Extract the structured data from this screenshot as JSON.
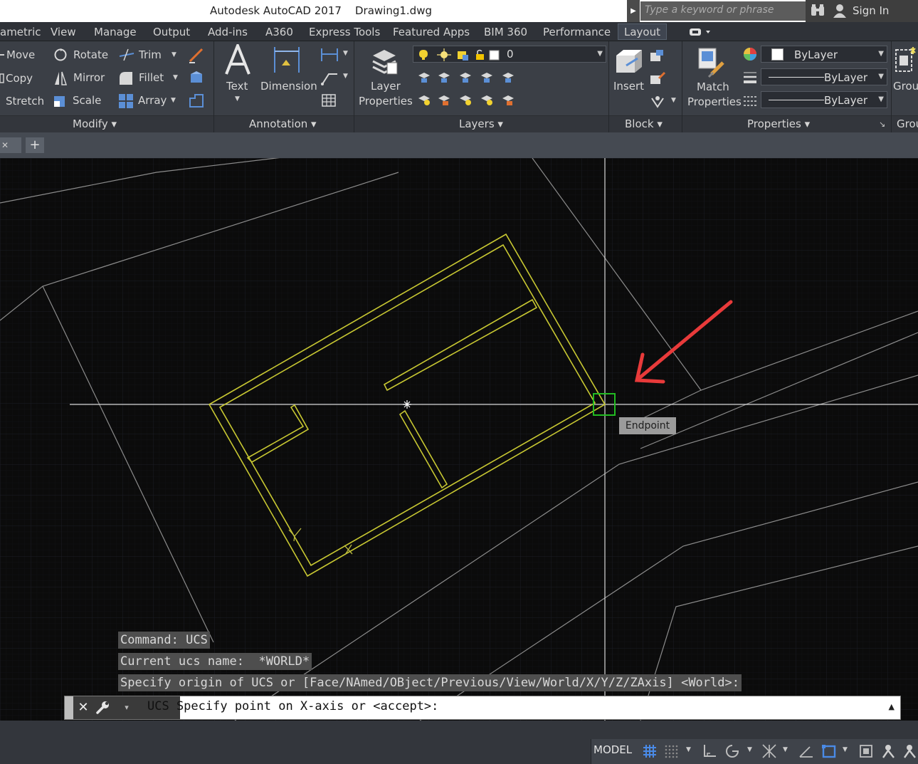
{
  "window": {
    "app_name": "Autodesk AutoCAD 2017",
    "document": "Drawing1.dwg",
    "search_placeholder": "Type a keyword or phrase",
    "sign_in": "Sign In"
  },
  "ribbon_tabs": [
    "ametric",
    "View",
    "Manage",
    "Output",
    "Add-ins",
    "A360",
    "Express Tools",
    "Featured Apps",
    "BIM 360",
    "Performance",
    "Layout"
  ],
  "active_tab": "Layout",
  "modify_panel": {
    "title": "Modify",
    "move": "Move",
    "rotate": "Rotate",
    "trim": "Trim",
    "copy": "Copy",
    "mirror": "Mirror",
    "fillet": "Fillet",
    "stretch": "Stretch",
    "scale": "Scale",
    "array": "Array"
  },
  "annotation_panel": {
    "title": "Annotation",
    "text": "Text",
    "dimension": "Dimension"
  },
  "layers_panel": {
    "title": "Layers",
    "layer_properties_1": "Layer",
    "layer_properties_2": "Properties",
    "current_layer": "0"
  },
  "block_panel": {
    "title": "Block",
    "insert": "Insert"
  },
  "properties_panel": {
    "title": "Properties",
    "match_1": "Match",
    "match_2": "Properties",
    "color": "ByLayer",
    "linetype": "ByLayer",
    "lineweight": "ByLayer"
  },
  "groups_panel": {
    "title": "Grou",
    "group": "Grou"
  },
  "canvas": {
    "osnap_tooltip": "Endpoint",
    "background": "#0b0b0b",
    "wall_color": "#c8c832",
    "arrow_color": "#e83a3a",
    "snap_marker_color": "#22bb22"
  },
  "command_history": [
    "Command: UCS",
    "Current ucs name:  *WORLD*",
    "Specify origin of UCS or [Face/NAmed/OBject/Previous/View/World/X/Y/Z/ZAxis] <World>:"
  ],
  "command_line": {
    "prompt": "UCS Specify point on X-axis or <accept>:"
  },
  "status_bar": {
    "model": "MODEL"
  }
}
